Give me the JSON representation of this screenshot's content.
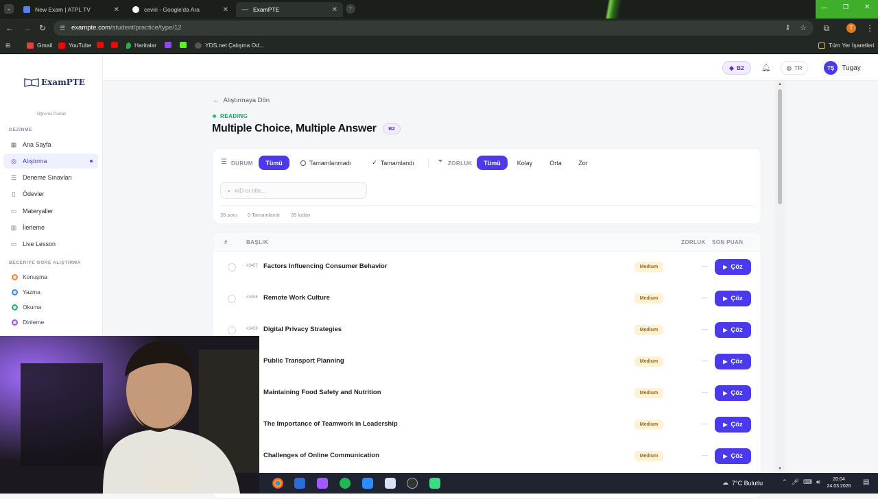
{
  "browser": {
    "tabs": [
      {
        "title": "New Exam | ATPL TV"
      },
      {
        "title": "ceviri - Google'da Ara"
      },
      {
        "title": "ExamPTE"
      }
    ],
    "url_host": "exampte.com",
    "url_path": "/student/practice/type/12",
    "bookmarks": [
      "Gmail",
      "YouTube",
      "Haritalar",
      "YDS.net Çalışma Od..."
    ],
    "bookmarks_right": "Tüm Yer İşaretleri",
    "profile_initial": "T"
  },
  "sidebar": {
    "logo": "ExamPTE",
    "portal": "Öğrenci Portalı",
    "section_nav": "GEZİNME",
    "items": [
      {
        "label": "Ana Sayfa",
        "icon": "grid-icon"
      },
      {
        "label": "Alıştırma",
        "icon": "target-icon",
        "active": true
      },
      {
        "label": "Deneme Sınavları",
        "icon": "list-icon"
      },
      {
        "label": "Ödevler",
        "icon": "book-icon"
      },
      {
        "label": "Materyaller",
        "icon": "folder-icon"
      },
      {
        "label": "İlerleme",
        "icon": "chart-icon"
      },
      {
        "label": "Live Lesson",
        "icon": "video-icon"
      }
    ],
    "section_skills": "BECERİYE GÖRE ALIŞTIRMA",
    "skills": [
      {
        "label": "Konuşma",
        "color": "#f08a3c"
      },
      {
        "label": "Yazma",
        "color": "#3a8ef0"
      },
      {
        "label": "Okuma",
        "color": "#26b36b"
      },
      {
        "label": "Dinleme",
        "color": "#9b59e0"
      }
    ]
  },
  "topbar": {
    "level": "B2",
    "language": "TR",
    "user_initials": "TŞ",
    "user_name": "Tugay"
  },
  "main": {
    "back": "Alıştırmaya Dön",
    "category": "READING",
    "title": "Multiple Choice, Multiple Answer",
    "level_badge": "B2",
    "filters": {
      "status_label": "DURUM",
      "status_options": [
        "Tümü",
        "Tamamlanmadı",
        "Tamamlandı"
      ],
      "difficulty_label": "ZORLUK",
      "difficulty_options": [
        "Tümü",
        "Kolay",
        "Orta",
        "Zor"
      ]
    },
    "search_placeholder": "#ID or title...",
    "stats": [
      "35 soru",
      "0 Tamamlandı",
      "35 kalan"
    ],
    "table_headers": {
      "num": "#",
      "title": "BAŞLIK",
      "difficulty": "ZORLUK",
      "score": "SON PUAN"
    },
    "solve_label": "Çöz",
    "rows": [
      {
        "id": "#3457",
        "title": "Factors Influencing Consumer Behavior",
        "difficulty": "Medium",
        "score": "—"
      },
      {
        "id": "#3458",
        "title": "Remote Work Culture",
        "difficulty": "Medium",
        "score": "—"
      },
      {
        "id": "#3459",
        "title": "Digital Privacy Strategies",
        "difficulty": "Medium",
        "score": "—"
      },
      {
        "id": "",
        "title": "Public Transport Planning",
        "difficulty": "Medium",
        "score": "—"
      },
      {
        "id": "",
        "title": "Maintaining Food Safety and Nutrition",
        "difficulty": "Medium",
        "score": "—"
      },
      {
        "id": "",
        "title": "The Importance of Teamwork in Leadership",
        "difficulty": "Medium",
        "score": "—"
      },
      {
        "id": "",
        "title": "Challenges of Online Communication",
        "difficulty": "Medium",
        "score": "—"
      }
    ]
  },
  "taskbar": {
    "weather": "7°C  Bulutlu",
    "time": "20:04",
    "date": "24.03.2026"
  },
  "colors": {
    "accent": "#4a3aeb",
    "medium_bg": "#fdf2d6",
    "medium_text": "#a1681b"
  }
}
